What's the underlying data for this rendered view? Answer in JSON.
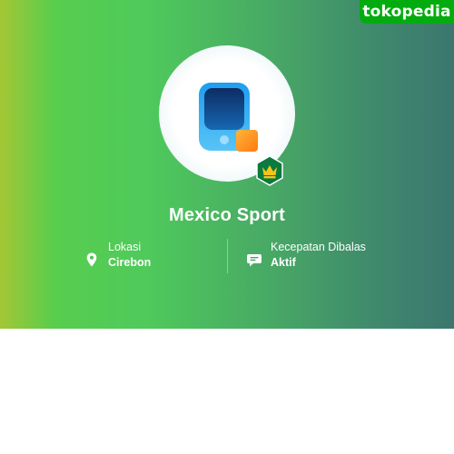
{
  "brand": {
    "logo_text": "tokopedia",
    "color": "#03ac0e"
  },
  "shop": {
    "name": "Mexico Sport",
    "badge_icon": "crown-icon"
  },
  "info": {
    "location": {
      "icon": "location-pin-icon",
      "label": "Lokasi",
      "value": "Cirebon"
    },
    "response_speed": {
      "icon": "chat-bubble-icon",
      "label": "Kecepatan Dibalas",
      "value": "Aktif"
    }
  },
  "colors": {
    "banner_gradient": [
      "#a4c734",
      "#4fca5b",
      "#3c766f"
    ],
    "badge_green": "#0b7a3e",
    "crown_yellow": "#f5c518"
  }
}
